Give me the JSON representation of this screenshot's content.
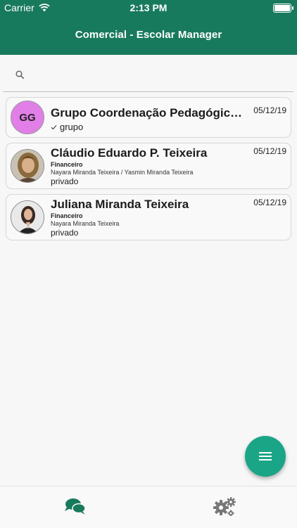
{
  "status_bar": {
    "carrier": "Carrier",
    "time": "2:13 PM"
  },
  "header": {
    "title": "Comercial - Escolar Manager"
  },
  "search": {
    "placeholder": "",
    "value": ""
  },
  "conversations": [
    {
      "initials": "GG",
      "name": "Grupo Coordenação Pedagógica - ...",
      "date": "05/12/19",
      "type_label": "grupo",
      "avatar_color": "#e27ee8"
    },
    {
      "name": "Cláudio Eduardo P. Teixeira",
      "date": "05/12/19",
      "role": "Financeiro",
      "people": "Nayara Miranda Teixeira / Yasmin Miranda Teixeira",
      "privacy": "privado"
    },
    {
      "name": "Juliana Miranda Teixeira",
      "date": "05/12/19",
      "role": "Financeiro",
      "people": "Nayara Miranda Teixeira",
      "privacy": "privado"
    }
  ],
  "tabbar": {
    "tabs": [
      {
        "icon": "chat-bubbles-icon",
        "active": true
      },
      {
        "icon": "gears-icon",
        "active": false
      }
    ]
  },
  "colors": {
    "brand": "#187a5c",
    "fab": "#1aa587",
    "group_avatar": "#e27ee8"
  }
}
